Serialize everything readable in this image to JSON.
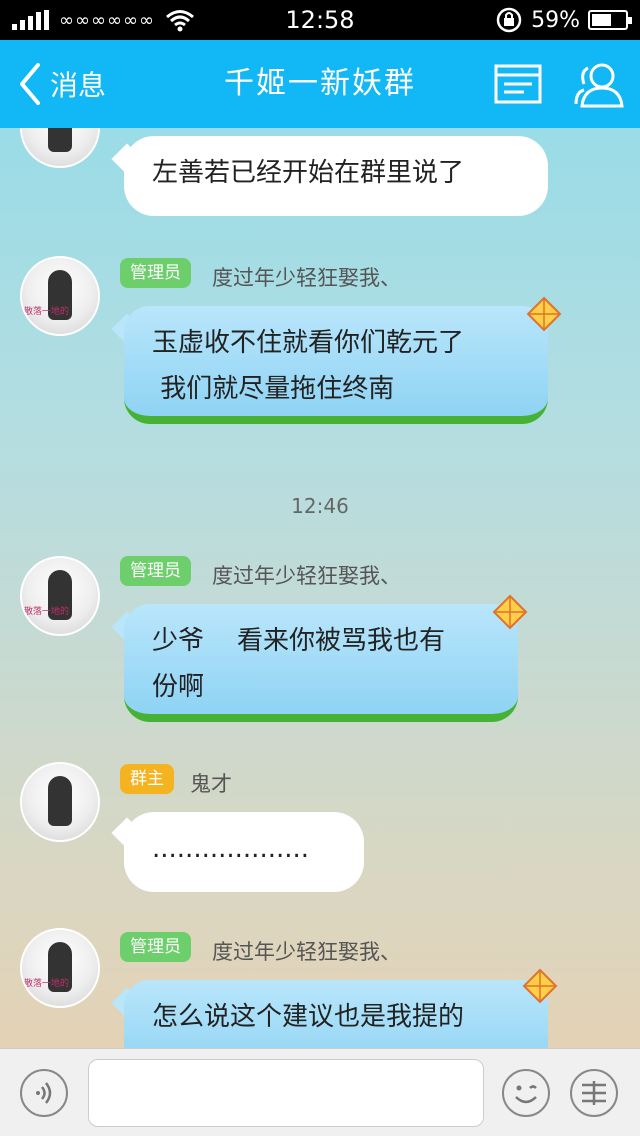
{
  "status_bar": {
    "carrier": "∞∞∞∞∞∞",
    "time": "12:58",
    "battery_percent_label": "59%",
    "battery_level": 0.59,
    "icons": [
      "signal-icon",
      "wifi-icon",
      "rotation-lock-icon",
      "battery-icon"
    ]
  },
  "header": {
    "back_label": "消息",
    "title": "千姬一新妖群",
    "icons": [
      "back-chevron-icon",
      "menu-list-icon",
      "members-icon"
    ]
  },
  "messages": [
    {
      "type": "white",
      "text": "左善若已经开始在群里说了"
    },
    {
      "type": "kite",
      "role": "管理员",
      "sender": "度过年少轻狂娶我、",
      "lines": [
        "玉虚收不住就看你们乾元了",
        " 我们就尽量拖住终南"
      ]
    },
    {
      "type": "time",
      "text": "12:46"
    },
    {
      "type": "kite",
      "role": "管理员",
      "sender": "度过年少轻狂娶我、",
      "lines": [
        "少爷    看来你被骂我也有",
        "份啊"
      ]
    },
    {
      "type": "white",
      "role": "群主",
      "sender": "鬼才",
      "text": "..................."
    },
    {
      "type": "kite",
      "role": "管理员",
      "sender": "度过年少轻狂娶我、",
      "lines": [
        "怎么说这个建议也是我提的"
      ]
    }
  ],
  "avatar_caption": "散落一地的",
  "input_bar": {
    "icons": [
      "voice-icon",
      "emoji-icon",
      "more-icon"
    ],
    "text_value": ""
  },
  "colors": {
    "header_bg": "#12b7f5",
    "admin_badge": "#6ccf6b",
    "owner_badge": "#f5b320",
    "kite_bubble": "#8fd3f4",
    "grass": "#45b235"
  }
}
